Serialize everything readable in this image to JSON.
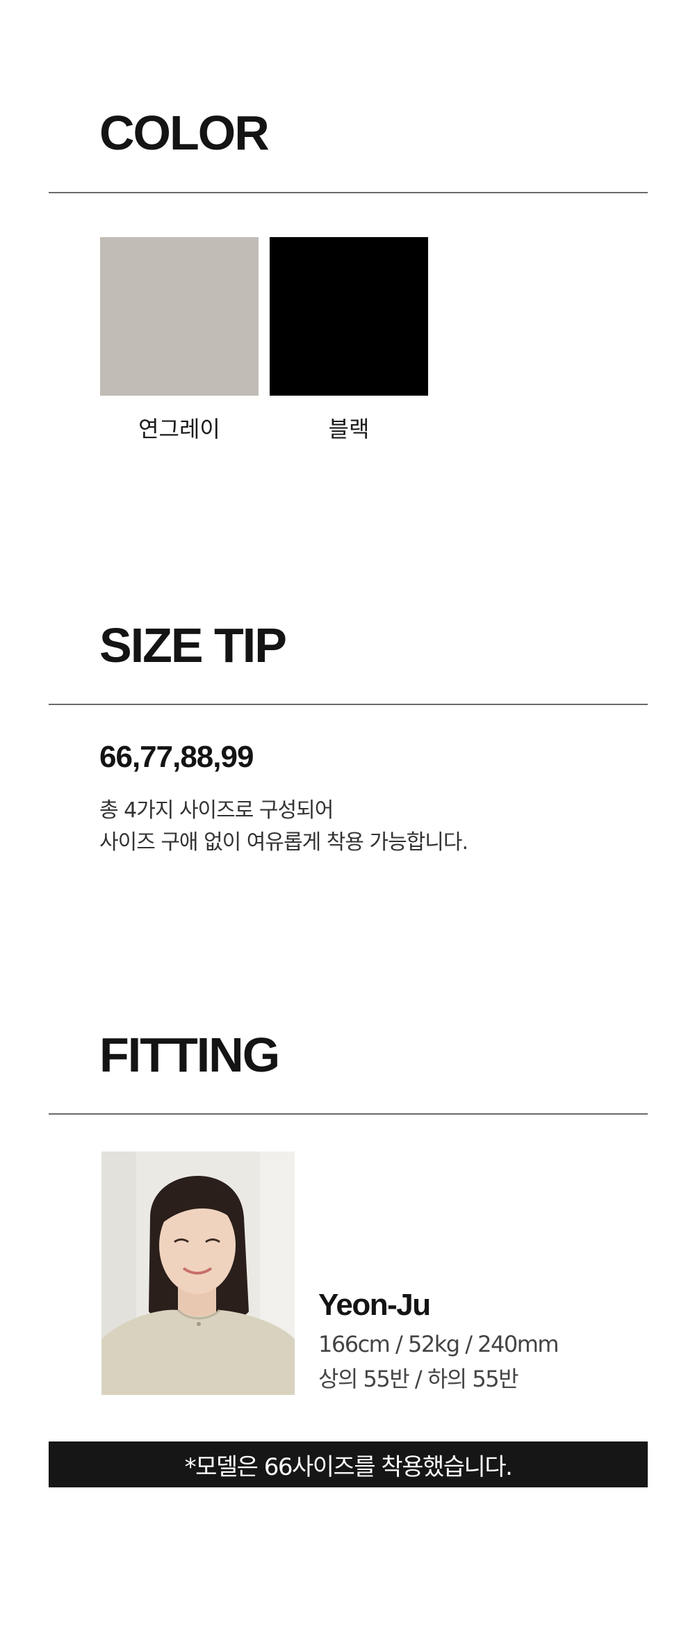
{
  "color_section": {
    "title": "COLOR",
    "swatches": [
      {
        "label": "연그레이",
        "color": "#c1bcb6"
      },
      {
        "label": "블랙",
        "color": "#000000"
      }
    ]
  },
  "size_section": {
    "title": "SIZE TIP",
    "sizes": "66,77,88,99",
    "desc_line1": "총 4가지 사이즈로 구성되어",
    "desc_line2": "사이즈 구애 없이 여유롭게 착용 가능합니다."
  },
  "fitting_section": {
    "title": "FITTING",
    "model_name": "Yeon-Ju",
    "model_stats": "166cm / 52kg / 240mm",
    "model_sizes": "상의 55반 / 하의 55반",
    "notice": "*모델은 66사이즈를 착용했습니다."
  }
}
